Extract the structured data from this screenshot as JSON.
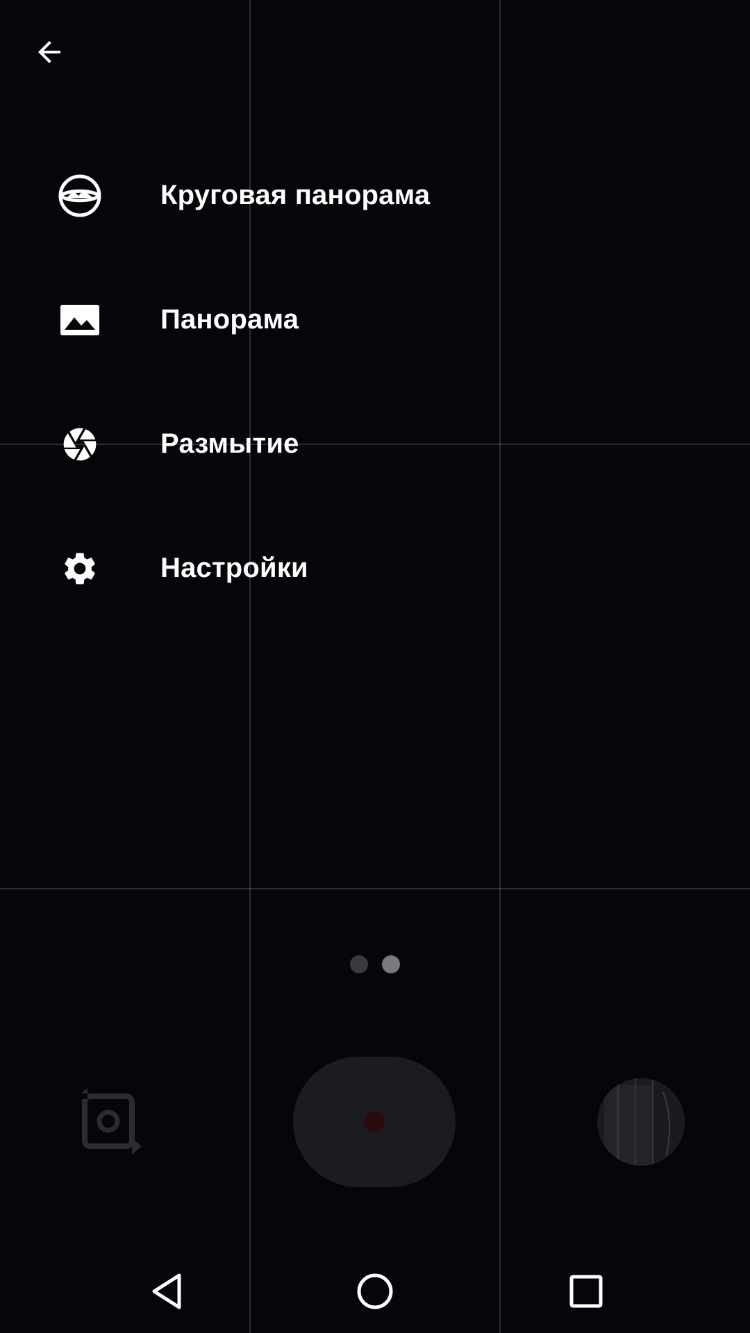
{
  "menu": {
    "items": [
      {
        "label": "Круговая панорама",
        "icon": "photo-sphere-icon"
      },
      {
        "label": "Панорама",
        "icon": "panorama-icon"
      },
      {
        "label": "Размытие",
        "icon": "aperture-icon"
      },
      {
        "label": "Настройки",
        "icon": "gear-icon"
      }
    ]
  },
  "pager": {
    "dots": 2,
    "active_index": 1
  },
  "colors": {
    "background": "#05050a",
    "text": "#ffffff",
    "grid": "#2a2a2e",
    "dot_inactive": "#3a3a3e",
    "dot_active": "#7a7a7e"
  },
  "icons": {
    "back": "arrow-left-icon",
    "switch_camera": "switch-camera-icon",
    "shutter": "record-dot-icon",
    "nav_back": "triangle-back-icon",
    "nav_home": "circle-home-icon",
    "nav_recents": "square-recents-icon"
  }
}
